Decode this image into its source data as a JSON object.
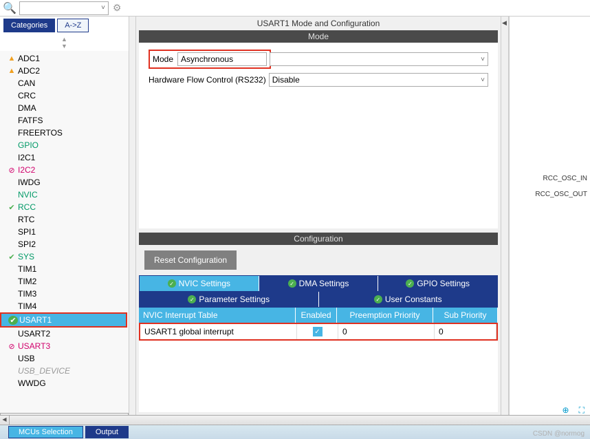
{
  "sidebar": {
    "tabs": [
      {
        "label": "Categories",
        "active": true
      },
      {
        "label": "A->Z",
        "active": false
      }
    ],
    "items": [
      {
        "label": "ADC1",
        "icon": "warn"
      },
      {
        "label": "ADC2",
        "icon": "warn"
      },
      {
        "label": "CAN"
      },
      {
        "label": "CRC"
      },
      {
        "label": "DMA"
      },
      {
        "label": "FATFS"
      },
      {
        "label": "FREERTOS"
      },
      {
        "label": "GPIO",
        "textClass": "green-text"
      },
      {
        "label": "I2C1"
      },
      {
        "label": "I2C2",
        "icon": "ban",
        "textClass": "pink-text"
      },
      {
        "label": "IWDG"
      },
      {
        "label": "NVIC",
        "textClass": "green-text"
      },
      {
        "label": "RCC",
        "icon": "check",
        "textClass": "green-text"
      },
      {
        "label": "RTC"
      },
      {
        "label": "SPI1"
      },
      {
        "label": "SPI2"
      },
      {
        "label": "SYS",
        "icon": "check",
        "textClass": "green-text"
      },
      {
        "label": "TIM1"
      },
      {
        "label": "TIM2"
      },
      {
        "label": "TIM3"
      },
      {
        "label": "TIM4"
      },
      {
        "label": "USART1",
        "icon": "check-white",
        "selected": true,
        "highlighted": true
      },
      {
        "label": "USART2"
      },
      {
        "label": "USART3",
        "icon": "ban",
        "textClass": "pink-text"
      },
      {
        "label": "USB"
      },
      {
        "label": "USB_DEVICE",
        "textClass": "italic-grey"
      },
      {
        "label": "WWDG"
      }
    ]
  },
  "center": {
    "title": "USART1 Mode and Configuration",
    "mode_header": "Mode",
    "mode_label": "Mode",
    "mode_value": "Asynchronous",
    "hw_label": "Hardware Flow Control (RS232)",
    "hw_value": "Disable",
    "config_header": "Configuration",
    "reset_btn": "Reset Configuration",
    "tabs_row1": [
      {
        "label": "NVIC Settings",
        "active": true
      },
      {
        "label": "DMA Settings"
      },
      {
        "label": "GPIO Settings"
      }
    ],
    "tabs_row2": [
      {
        "label": "Parameter Settings"
      },
      {
        "label": "User Constants"
      }
    ],
    "nvic_headers": {
      "name": "NVIC Interrupt Table",
      "enabled": "Enabled",
      "preempt": "Preemption Priority",
      "sub": "Sub Priority"
    },
    "nvic_row": {
      "name": "USART1 global interrupt",
      "enabled": true,
      "preempt": "0",
      "sub": "0"
    }
  },
  "right": {
    "osc_in": "RCC_OSC_IN",
    "osc_out": "RCC_OSC_OUT"
  },
  "bottom": {
    "tab1": "MCUs Selection",
    "tab2": "Output"
  },
  "watermark": "CSDN @normog"
}
